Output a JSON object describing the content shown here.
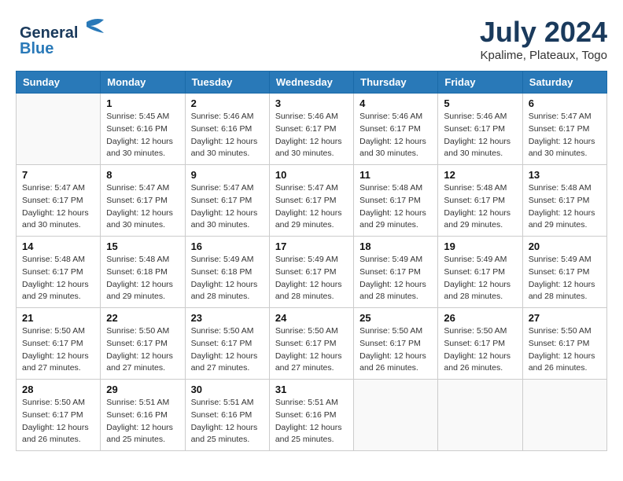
{
  "header": {
    "logo_line1": "General",
    "logo_line2": "Blue",
    "month_year": "July 2024",
    "location": "Kpalime, Plateaux, Togo"
  },
  "weekdays": [
    "Sunday",
    "Monday",
    "Tuesday",
    "Wednesday",
    "Thursday",
    "Friday",
    "Saturday"
  ],
  "weeks": [
    [
      {
        "day": "",
        "info": ""
      },
      {
        "day": "1",
        "info": "Sunrise: 5:45 AM\nSunset: 6:16 PM\nDaylight: 12 hours\nand 30 minutes."
      },
      {
        "day": "2",
        "info": "Sunrise: 5:46 AM\nSunset: 6:16 PM\nDaylight: 12 hours\nand 30 minutes."
      },
      {
        "day": "3",
        "info": "Sunrise: 5:46 AM\nSunset: 6:17 PM\nDaylight: 12 hours\nand 30 minutes."
      },
      {
        "day": "4",
        "info": "Sunrise: 5:46 AM\nSunset: 6:17 PM\nDaylight: 12 hours\nand 30 minutes."
      },
      {
        "day": "5",
        "info": "Sunrise: 5:46 AM\nSunset: 6:17 PM\nDaylight: 12 hours\nand 30 minutes."
      },
      {
        "day": "6",
        "info": "Sunrise: 5:47 AM\nSunset: 6:17 PM\nDaylight: 12 hours\nand 30 minutes."
      }
    ],
    [
      {
        "day": "7",
        "info": "Sunrise: 5:47 AM\nSunset: 6:17 PM\nDaylight: 12 hours\nand 30 minutes."
      },
      {
        "day": "8",
        "info": "Sunrise: 5:47 AM\nSunset: 6:17 PM\nDaylight: 12 hours\nand 30 minutes."
      },
      {
        "day": "9",
        "info": "Sunrise: 5:47 AM\nSunset: 6:17 PM\nDaylight: 12 hours\nand 30 minutes."
      },
      {
        "day": "10",
        "info": "Sunrise: 5:47 AM\nSunset: 6:17 PM\nDaylight: 12 hours\nand 29 minutes."
      },
      {
        "day": "11",
        "info": "Sunrise: 5:48 AM\nSunset: 6:17 PM\nDaylight: 12 hours\nand 29 minutes."
      },
      {
        "day": "12",
        "info": "Sunrise: 5:48 AM\nSunset: 6:17 PM\nDaylight: 12 hours\nand 29 minutes."
      },
      {
        "day": "13",
        "info": "Sunrise: 5:48 AM\nSunset: 6:17 PM\nDaylight: 12 hours\nand 29 minutes."
      }
    ],
    [
      {
        "day": "14",
        "info": "Sunrise: 5:48 AM\nSunset: 6:17 PM\nDaylight: 12 hours\nand 29 minutes."
      },
      {
        "day": "15",
        "info": "Sunrise: 5:48 AM\nSunset: 6:18 PM\nDaylight: 12 hours\nand 29 minutes."
      },
      {
        "day": "16",
        "info": "Sunrise: 5:49 AM\nSunset: 6:18 PM\nDaylight: 12 hours\nand 28 minutes."
      },
      {
        "day": "17",
        "info": "Sunrise: 5:49 AM\nSunset: 6:17 PM\nDaylight: 12 hours\nand 28 minutes."
      },
      {
        "day": "18",
        "info": "Sunrise: 5:49 AM\nSunset: 6:17 PM\nDaylight: 12 hours\nand 28 minutes."
      },
      {
        "day": "19",
        "info": "Sunrise: 5:49 AM\nSunset: 6:17 PM\nDaylight: 12 hours\nand 28 minutes."
      },
      {
        "day": "20",
        "info": "Sunrise: 5:49 AM\nSunset: 6:17 PM\nDaylight: 12 hours\nand 28 minutes."
      }
    ],
    [
      {
        "day": "21",
        "info": "Sunrise: 5:50 AM\nSunset: 6:17 PM\nDaylight: 12 hours\nand 27 minutes."
      },
      {
        "day": "22",
        "info": "Sunrise: 5:50 AM\nSunset: 6:17 PM\nDaylight: 12 hours\nand 27 minutes."
      },
      {
        "day": "23",
        "info": "Sunrise: 5:50 AM\nSunset: 6:17 PM\nDaylight: 12 hours\nand 27 minutes."
      },
      {
        "day": "24",
        "info": "Sunrise: 5:50 AM\nSunset: 6:17 PM\nDaylight: 12 hours\nand 27 minutes."
      },
      {
        "day": "25",
        "info": "Sunrise: 5:50 AM\nSunset: 6:17 PM\nDaylight: 12 hours\nand 26 minutes."
      },
      {
        "day": "26",
        "info": "Sunrise: 5:50 AM\nSunset: 6:17 PM\nDaylight: 12 hours\nand 26 minutes."
      },
      {
        "day": "27",
        "info": "Sunrise: 5:50 AM\nSunset: 6:17 PM\nDaylight: 12 hours\nand 26 minutes."
      }
    ],
    [
      {
        "day": "28",
        "info": "Sunrise: 5:50 AM\nSunset: 6:17 PM\nDaylight: 12 hours\nand 26 minutes."
      },
      {
        "day": "29",
        "info": "Sunrise: 5:51 AM\nSunset: 6:16 PM\nDaylight: 12 hours\nand 25 minutes."
      },
      {
        "day": "30",
        "info": "Sunrise: 5:51 AM\nSunset: 6:16 PM\nDaylight: 12 hours\nand 25 minutes."
      },
      {
        "day": "31",
        "info": "Sunrise: 5:51 AM\nSunset: 6:16 PM\nDaylight: 12 hours\nand 25 minutes."
      },
      {
        "day": "",
        "info": ""
      },
      {
        "day": "",
        "info": ""
      },
      {
        "day": "",
        "info": ""
      }
    ]
  ]
}
